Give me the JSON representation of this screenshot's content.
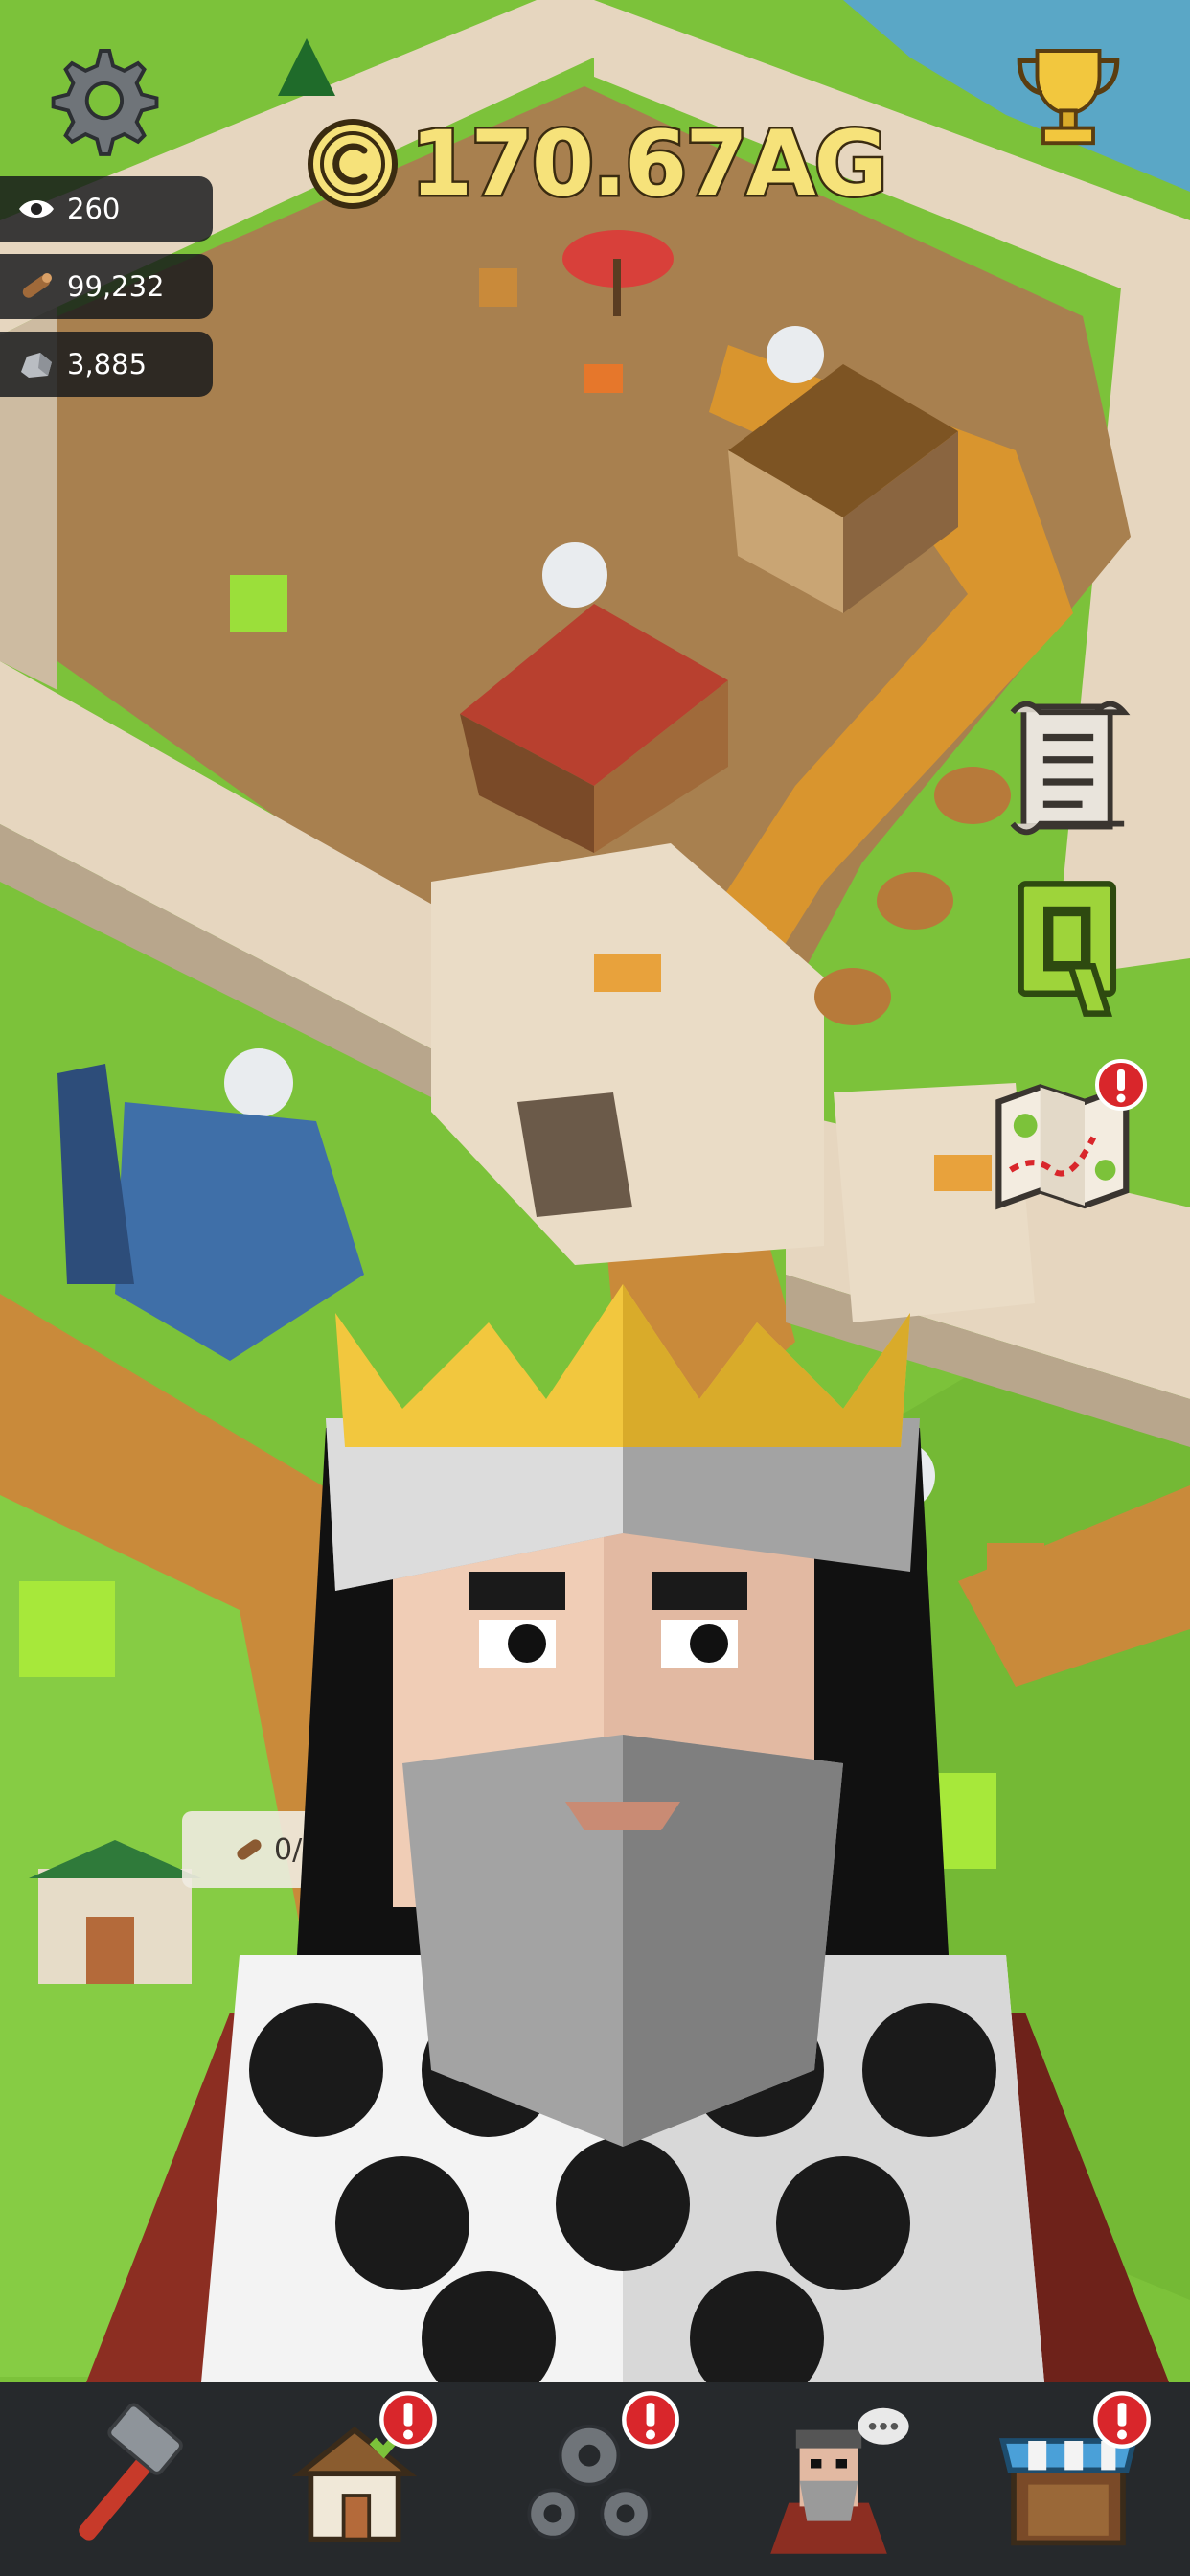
{
  "hud": {
    "currency_value": "170.67AG",
    "stats": [
      {
        "icon": "eye-icon",
        "value": "260"
      },
      {
        "icon": "wood-log-icon",
        "value": "99,232"
      },
      {
        "icon": "stone-icon",
        "value": "3,885"
      }
    ]
  },
  "building_card": {
    "requirement": "0/2"
  },
  "side_buttons": [
    "scroll-icon",
    "quest-q-icon",
    "map-icon"
  ],
  "bottom_nav": [
    {
      "icon": "hammer-icon",
      "badge": ""
    },
    {
      "icon": "house-build-icon",
      "badge": "!"
    },
    {
      "icon": "gears-icon",
      "badge": "!"
    },
    {
      "icon": "advisor-chat-icon",
      "badge": ""
    },
    {
      "icon": "market-stall-icon",
      "badge": "!"
    }
  ],
  "colors": {
    "grass": "#7cc23a",
    "dirt": "#c98a3a",
    "courtyard": "#a8804f",
    "wall": "#e6d6bf",
    "currency_gold": "#f6e27a",
    "badge_red": "#d9262b",
    "nav_bg": "#26292c"
  }
}
